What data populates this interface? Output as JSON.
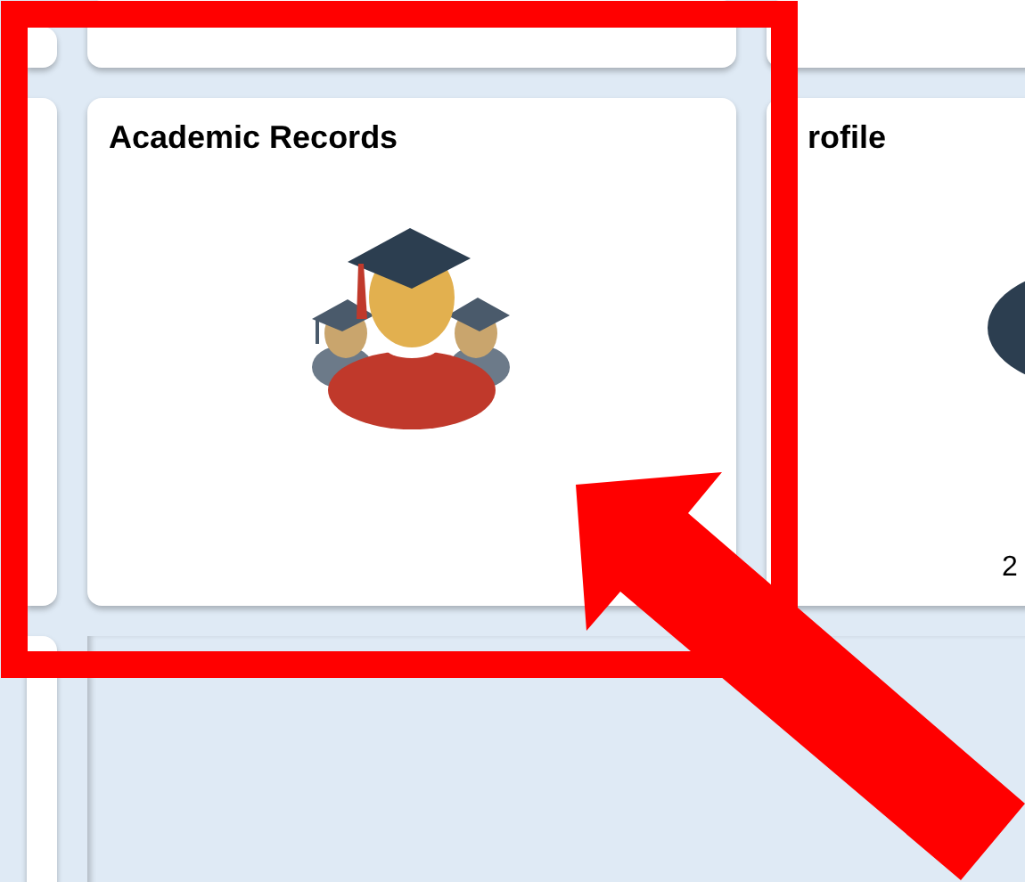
{
  "tiles": [
    {
      "title": "Academic Records",
      "kind": "graduates"
    },
    {
      "title": "rofile",
      "kind": "profile",
      "footer": "2"
    }
  ],
  "annotations": {
    "box": true,
    "arrow": true
  }
}
